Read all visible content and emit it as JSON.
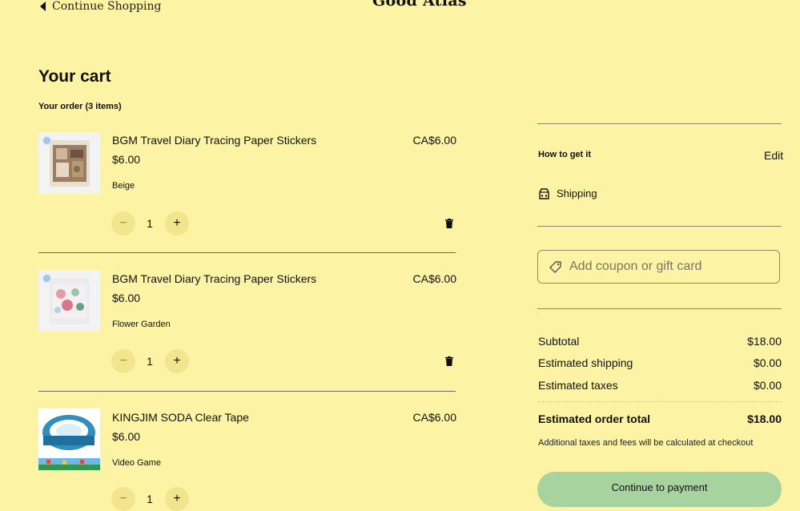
{
  "header": {
    "continue_label": "Continue Shopping",
    "brand": "Good Atlas"
  },
  "cart": {
    "title": "Your cart",
    "order_count": "Your order (3 items)",
    "items": [
      {
        "title": "BGM Travel Diary Tracing Paper Stickers",
        "unit_price": "$6.00",
        "variant": "Beige",
        "line_price": "CA$6.00",
        "quantity": "1",
        "minus": "−",
        "plus": "+"
      },
      {
        "title": "BGM Travel Diary Tracing Paper Stickers",
        "unit_price": "$6.00",
        "variant": "Flower Garden",
        "line_price": "CA$6.00",
        "quantity": "1",
        "minus": "−",
        "plus": "+"
      },
      {
        "title": "KINGJIM SODA Clear Tape",
        "unit_price": "$6.00",
        "variant": "Video Game",
        "line_price": "CA$6.00",
        "quantity": "1",
        "minus": "−",
        "plus": "+"
      }
    ]
  },
  "summary": {
    "how_to_get": "How to get it",
    "edit": "Edit",
    "shipping_method": "Shipping",
    "coupon_placeholder": "Add coupon or gift card",
    "subtotal_label": "Subtotal",
    "subtotal_value": "$18.00",
    "shipping_label": "Estimated shipping",
    "shipping_value": "$0.00",
    "taxes_label": "Estimated taxes",
    "taxes_value": "$0.00",
    "total_label": "Estimated order total",
    "total_value": "$18.00",
    "note": "Additional taxes and fees will be calculated at checkout",
    "pay_label": "Continue to payment"
  },
  "colors": {
    "background": "#fcf3a4",
    "qty_button": "#f3e58d",
    "pay_button": "#a7d39f"
  },
  "icons": [
    "caret-left-icon",
    "trash-icon",
    "truck-icon",
    "tag-icon"
  ]
}
